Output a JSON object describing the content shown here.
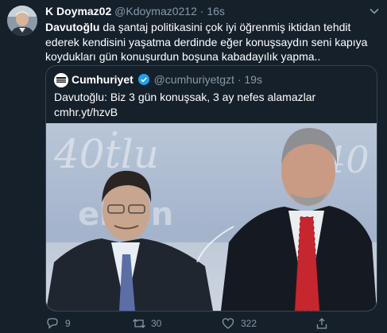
{
  "tweet": {
    "display_name": "K Doymaz02",
    "handle": "@Kdoymaz0212",
    "separator": "·",
    "time": "16s",
    "text_bold": "Davutoğlu",
    "text_rest": " da şantaj politikasini çok iyi öğrenmiş iktidan tehdit ederek kendisini yaşatma derdinde eğer konuşsaydın seni kapıya koydukları gün konuşurdun boşuna kabadayılık yapma..",
    "icons": {
      "more": "chevron-down-icon"
    }
  },
  "quoted": {
    "display_name": "Cumhuriyet",
    "handle": "@cumhuriyetgzt",
    "separator": "·",
    "time": "19s",
    "text_line1": "Davutoğlu: Biz 3 gün konuşsak, 3 ay nefes alamazlar",
    "text_line2": "cmhr.yt/hzvB",
    "image_banner_text_left": "40ṫlu",
    "image_banner_text_right": "40",
    "image_banner_text_lower": "elsen",
    "verified_color": "#1da1f2"
  },
  "actions": {
    "reply_count": "9",
    "retweet_count": "30",
    "like_count": "322"
  },
  "colors": {
    "background": "#15202b",
    "border": "#38444d",
    "muted": "#8899a6",
    "text": "#ffffff"
  }
}
